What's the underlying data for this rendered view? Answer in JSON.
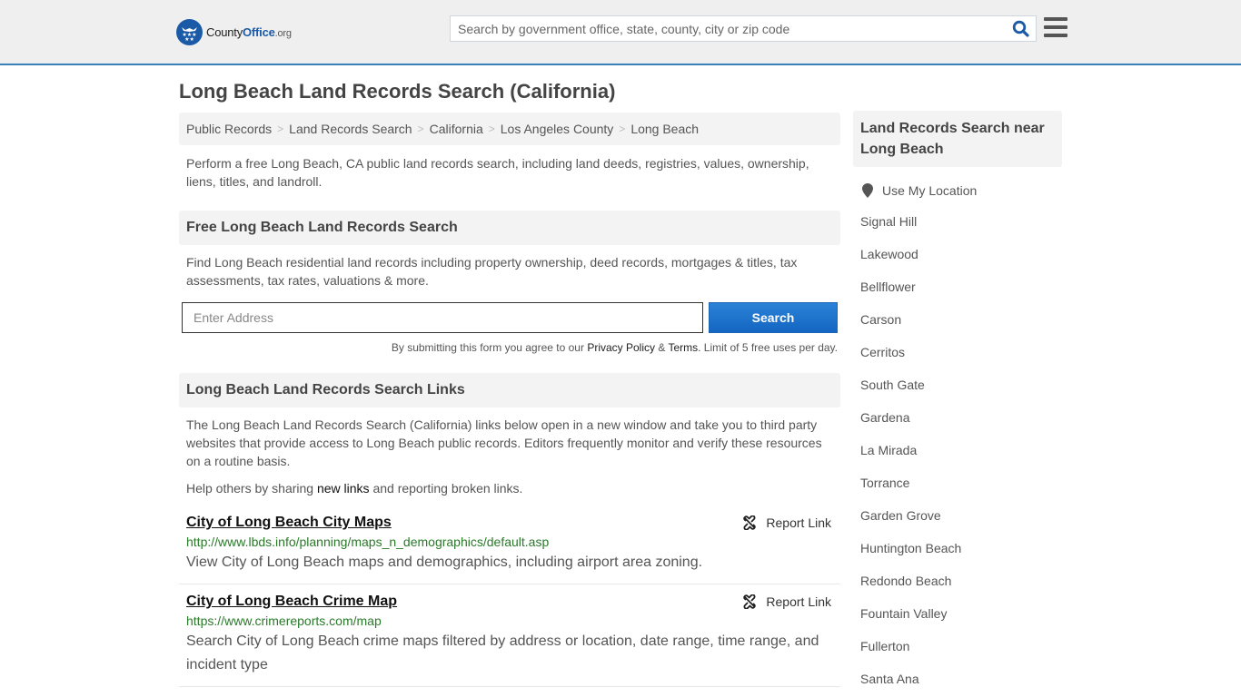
{
  "header": {
    "logo": {
      "name_part1": "County",
      "name_part2": "Office",
      "name_part3": ".org"
    },
    "search_placeholder": "Search by government office, state, county, city or zip code",
    "icons": {
      "search": "search-icon",
      "menu": "hamburger-menu-icon"
    }
  },
  "page_title": "Long Beach Land Records Search (California)",
  "breadcrumb": [
    {
      "label": "Public Records"
    },
    {
      "label": "Land Records Search"
    },
    {
      "label": "California"
    },
    {
      "label": "Los Angeles County"
    },
    {
      "label": "Long Beach"
    }
  ],
  "intro": "Perform a free Long Beach, CA public land records search, including land deeds, registries, values, ownership, liens, titles, and landroll.",
  "free_search": {
    "heading": "Free Long Beach Land Records Search",
    "description": "Find Long Beach residential land records including property ownership, deed records, mortgages & titles, tax assessments, tax rates, valuations & more.",
    "input_placeholder": "Enter Address",
    "button_label": "Search",
    "disclaimer_prefix": "By submitting this form you agree to our ",
    "privacy_label": "Privacy Policy",
    "amp": " & ",
    "terms_label": "Terms",
    "disclaimer_suffix": ". Limit of 5 free uses per day."
  },
  "links_section": {
    "heading": "Long Beach Land Records Search Links",
    "description": "The Long Beach Land Records Search (California) links below open in a new window and take you to third party websites that provide access to Long Beach public records. Editors frequently monitor and verify these resources on a routine basis.",
    "help_prefix": "Help others by sharing ",
    "help_link": "new links",
    "help_suffix": " and reporting broken links.",
    "report_label": "Report Link",
    "items": [
      {
        "title": "City of Long Beach City Maps",
        "url": "http://www.lbds.info/planning/maps_n_demographics/default.asp",
        "description": "View City of Long Beach maps and demographics, including airport area zoning."
      },
      {
        "title": "City of Long Beach Crime Map",
        "url": "https://www.crimereports.com/map",
        "description": "Search City of Long Beach crime maps filtered by address or location, date range, time range, and incident type"
      }
    ]
  },
  "sidebar": {
    "heading": "Land Records Search near Long Beach",
    "use_location": "Use My Location",
    "cities": [
      "Signal Hill",
      "Lakewood",
      "Bellflower",
      "Carson",
      "Cerritos",
      "South Gate",
      "Gardena",
      "La Mirada",
      "Torrance",
      "Garden Grove",
      "Huntington Beach",
      "Redondo Beach",
      "Fountain Valley",
      "Fullerton",
      "Santa Ana"
    ]
  },
  "colors": {
    "brand_blue": "#1b5aa6",
    "header_border": "#3a7fb8",
    "button_blue": "#1466c2",
    "url_green": "#2a7a2a"
  }
}
